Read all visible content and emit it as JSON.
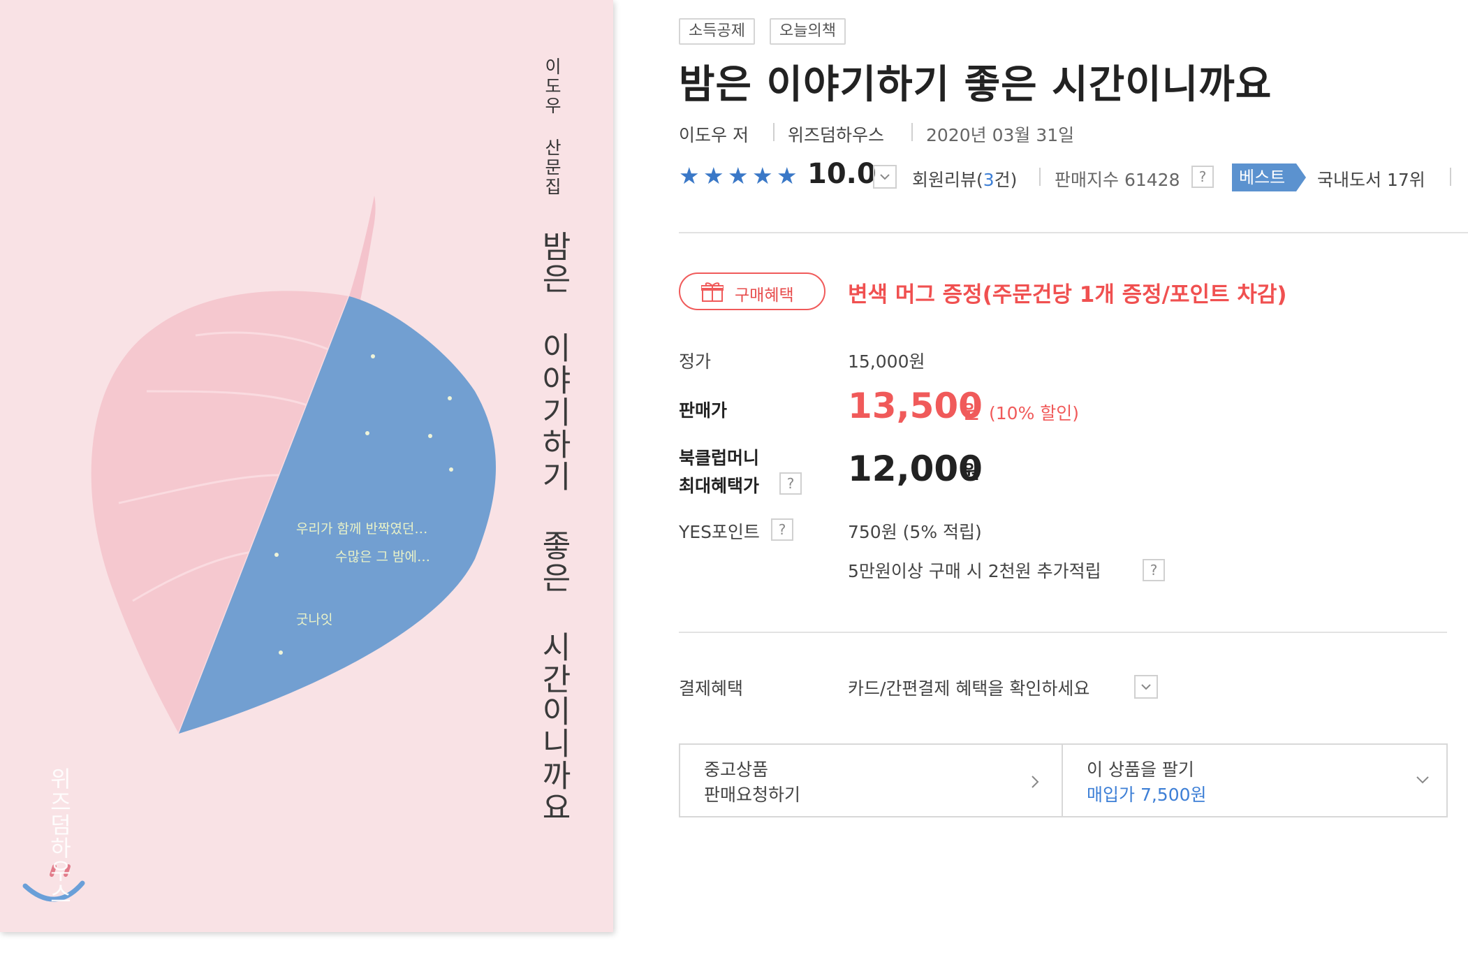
{
  "cover": {
    "author_line": "이도우 산문집",
    "title": "밤은 이야기하기 좋은 시간이니까요",
    "lines": [
      "우리가 함께 반짝였던…",
      "수많은 그 밤에…",
      "굿나잇"
    ],
    "publisher": "위즈덤하우스",
    "colors": {
      "background": "#f9e2e5",
      "leaf_pink": "#f5c8cf",
      "leaf_blue": "#729fd1"
    }
  },
  "tags": [
    "소득공제",
    "오늘의책"
  ],
  "title": "밤은 이야기하기 좋은 시간이니까요",
  "meta": {
    "author": "이도우 저",
    "publisher": "위즈덤하우스",
    "date": "2020년 03월 31일"
  },
  "rating": {
    "stars": 5,
    "score": "10.0",
    "review_label": "회원리뷰(",
    "review_count": "3",
    "review_suffix": "건)",
    "sales_index": "판매지수 61428",
    "best_label": "베스트",
    "rank": "국내도서 17위"
  },
  "benefit": {
    "button_label": "구매혜택",
    "text": "변색 머그 증정(주문건당 1개 증정/포인트 차감)"
  },
  "price": {
    "list_label": "정가",
    "list_value": "15,000원",
    "sale_label": "판매가",
    "sale_value": "13,500",
    "sale_unit": "원",
    "discount": "(10% 할인)",
    "club_label_1": "북클럽머니",
    "club_label_2": "최대혜택가",
    "club_value": "12,000",
    "club_unit": "원",
    "points_label": "YES포인트",
    "points_value": "750원 (5% 적립)",
    "points_extra": "5만원이상 구매 시 2천원 추가적립"
  },
  "payment": {
    "label": "결제혜택",
    "value": "카드/간편결제 혜택을 확인하세요"
  },
  "used": {
    "line1": "중고상품",
    "line2": "판매요청하기"
  },
  "sell": {
    "line1": "이 상품을 팔기",
    "line2": "매입가 7,500원"
  },
  "colors": {
    "accent_red": "#f05a5a",
    "accent_blue": "#3a78c7",
    "badge_blue": "#5b92cf",
    "link_blue": "#3d7fd6"
  }
}
